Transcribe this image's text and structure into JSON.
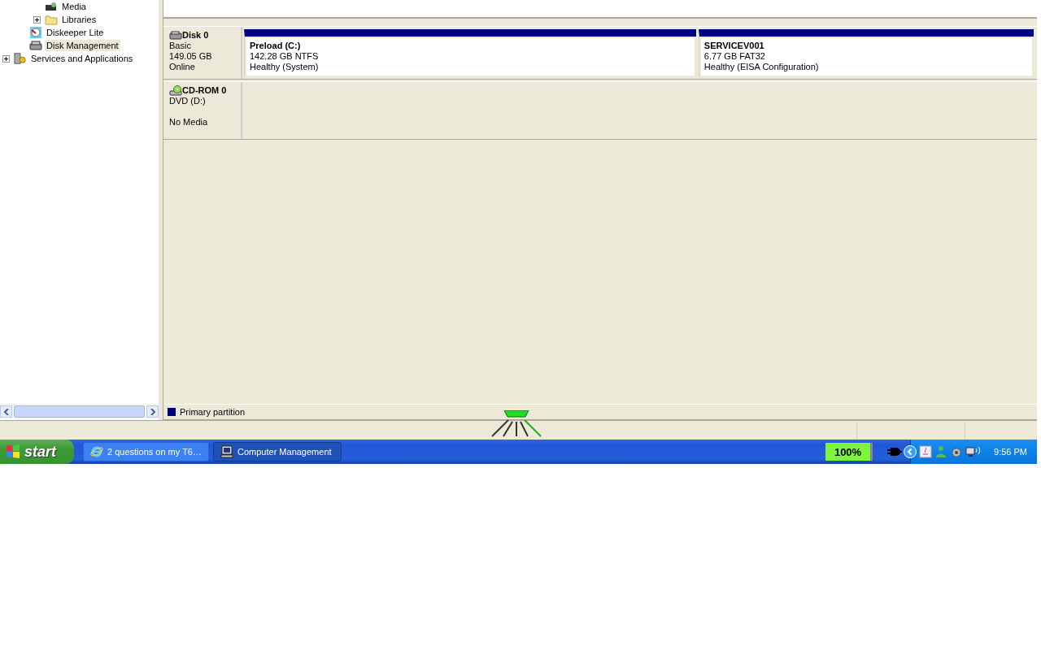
{
  "tree": {
    "items": [
      {
        "children": [
          {
            "children": [
              {
                "label": "Media",
                "selected": false,
                "kind": "media"
              },
              {
                "label": "Libraries",
                "selected": false,
                "expanded": false,
                "kind": "folder"
              }
            ]
          },
          {
            "label": "Diskeeper Lite",
            "selected": false,
            "kind": "defrag"
          },
          {
            "label": "Disk Management",
            "selected": true,
            "kind": "disk"
          }
        ]
      },
      {
        "label": "Services and Applications",
        "selected": false,
        "expanded": false,
        "kind": "services"
      }
    ]
  },
  "disks": [
    {
      "kind": "disk",
      "name": "Disk 0",
      "type": "Basic",
      "size": "149.05 GB",
      "status": "Online",
      "partitions": [
        {
          "name": "Preload  (C:)",
          "size": "142.28 GB NTFS",
          "status": "Healthy (System)"
        },
        {
          "name": "SERVICEV001",
          "size": "6.77 GB FAT32",
          "status": "Healthy (EISA Configuration)"
        }
      ]
    },
    {
      "kind": "cdrom",
      "name": "CD-ROM 0",
      "type": "DVD (D:)",
      "status": "No Media"
    }
  ],
  "legend": [
    {
      "label": "Primary partition",
      "color": "#000080"
    }
  ],
  "taskbar": {
    "start": "start",
    "tasks": [
      {
        "label": "2 questions on my T6…",
        "kind": "browser",
        "selected": false
      },
      {
        "label": "Computer Management",
        "kind": "computer",
        "selected": true
      }
    ],
    "battery": {
      "reading": "100%",
      "level": 1
    },
    "clock": "9:56 PM"
  }
}
